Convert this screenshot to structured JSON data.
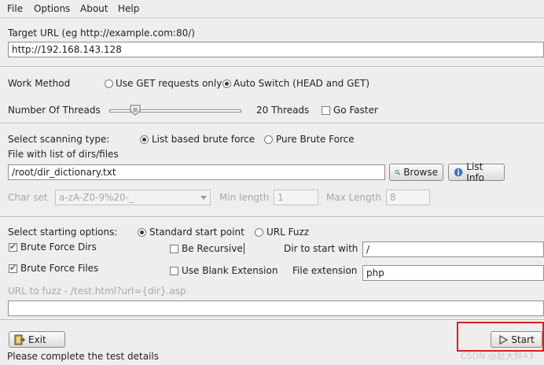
{
  "menu": {
    "items": [
      "File",
      "Options",
      "About",
      "Help"
    ]
  },
  "target": {
    "label": "Target URL (eg http://example.com:80/)",
    "value": "http://192.168.143.128"
  },
  "work_method": {
    "label": "Work Method",
    "option_get": "Use GET requests only",
    "option_auto": "Auto Switch (HEAD and GET)",
    "selected": "auto"
  },
  "threads": {
    "label": "Number Of Threads",
    "count_text": "20 Threads",
    "go_faster": "Go Faster",
    "value": 20
  },
  "scan_type": {
    "label": "Select scanning type:",
    "option_list": "List based brute force",
    "option_pure": "Pure Brute Force",
    "selected": "list"
  },
  "dirs_file": {
    "label": "File with list of dirs/files",
    "value": "/root/dir_dictionary.txt",
    "browse": "Browse",
    "list_info": "List Info"
  },
  "charset": {
    "label": "Char set",
    "value": "a-zA-Z0-9%20-_",
    "min_label": "Min length",
    "min_value": "1",
    "max_label": "Max Length",
    "max_value": "8"
  },
  "start_options": {
    "label": "Select starting options:",
    "option_standard": "Standard start point",
    "option_url_fuzz": "URL Fuzz",
    "selected": "standard"
  },
  "brute_dirs": {
    "label": "Brute Force Dirs",
    "checked": true
  },
  "be_recursive": {
    "label": "Be Recursive",
    "checked": false
  },
  "dir_start": {
    "label": "Dir to start with",
    "value": "/"
  },
  "brute_files": {
    "label": "Brute Force Files",
    "checked": true
  },
  "blank_ext": {
    "label": "Use Blank Extension",
    "checked": false
  },
  "file_ext": {
    "label": "File extension",
    "value": "php"
  },
  "url_fuzz": {
    "label": "URL to fuzz - /test.html?url={dir}.asp",
    "value": ""
  },
  "buttons": {
    "exit": "Exit",
    "start": "Start"
  },
  "status": {
    "text": "Please complete the test details"
  },
  "watermark": "CSDN @赵大胖43",
  "colors": {
    "highlight": "#d8201c",
    "check": "#3f7f2a"
  }
}
